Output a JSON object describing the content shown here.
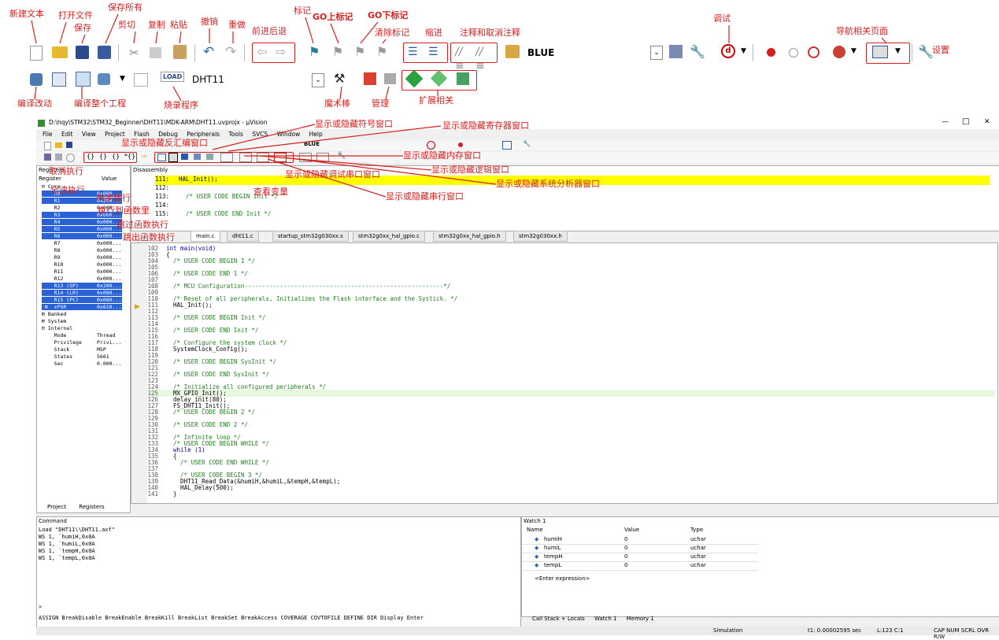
{
  "toolbar_font_combo": "BLUE",
  "target_combo": "DHT11",
  "load_label": "LOAD",
  "annotations": {
    "new_file": "新建文本",
    "open_file": "打开文件",
    "save": "保存",
    "save_all": "保存所有",
    "cut": "剪切",
    "copy": "复制",
    "paste": "粘贴",
    "undo": "撤销",
    "redo": "重做",
    "nav_back_forward": "前进后退",
    "bookmark": "标记",
    "goto_prev_bookmark": "GO上标记",
    "goto_next_bookmark": "GO下标记",
    "clear_bookmarks": "清除标记",
    "indent": "缩进",
    "comment_uncomment": "注释和取消注释",
    "debug": "调试",
    "nav_pages": "导航相关页面",
    "settings": "设置",
    "compile_changed": "编译改动",
    "build_all": "编译整个工程",
    "download": "烧录程序",
    "magic_wand": "魔术棒",
    "manage": "管理",
    "extensions": "扩展相关",
    "show_symbol": "显示或隐藏符号窗口",
    "show_register": "显示或隐藏寄存器窗口",
    "show_disasm": "显示或隐藏反汇编窗口",
    "show_memory": "显示或隐藏内存窗口",
    "show_logic": "显示或隐藏逻辑窗口",
    "show_debug_serial": "显示或隐藏调试串口窗口",
    "show_serial": "显示或隐藏串行窗口",
    "show_sys_analyzer": "显示或隐藏系统分析器窗口",
    "watch_vars": "查看变量",
    "cancel_run": "取消执行",
    "run": "全速执行",
    "step": "单步执行",
    "step_into": "执行到函数里",
    "step_over": "跳过函数执行",
    "step_out": "跳出函数执行"
  },
  "window": {
    "title": "D:\\hqy\\STM32\\STM32_Beginner\\DHT11\\MDK-ARM\\DHT11.uvprojx - µVision",
    "menu": [
      "File",
      "Edit",
      "View",
      "Project",
      "Flash",
      "Debug",
      "Peripherals",
      "Tools",
      "SVCS",
      "Window",
      "Help"
    ],
    "mini_font_combo": "BLUE",
    "min": "—",
    "max": "□",
    "close": "✕"
  },
  "registers": {
    "title": "Registers",
    "col_register": "Register",
    "col_value": "Value",
    "rows": [
      {
        "name": "⊟ Core",
        "value": "",
        "sel": false
      },
      {
        "name": "    R0",
        "value": "0x080...",
        "sel": true
      },
      {
        "name": "    R1",
        "value": "0x200...",
        "sel": true
      },
      {
        "name": "    R2",
        "value": "0x000...",
        "sel": false
      },
      {
        "name": "    R3",
        "value": "0x000...",
        "sel": true
      },
      {
        "name": "    R4",
        "value": "0x000...",
        "sel": true
      },
      {
        "name": "    R5",
        "value": "0x000...",
        "sel": true
      },
      {
        "name": "    R6",
        "value": "0x000...",
        "sel": true
      },
      {
        "name": "    R7",
        "value": "0x000...",
        "sel": false
      },
      {
        "name": "    R8",
        "value": "0x000...",
        "sel": false
      },
      {
        "name": "    R9",
        "value": "0x000...",
        "sel": false
      },
      {
        "name": "    R10",
        "value": "0x000...",
        "sel": false
      },
      {
        "name": "    R11",
        "value": "0x000...",
        "sel": false
      },
      {
        "name": "    R12",
        "value": "0x000...",
        "sel": false
      },
      {
        "name": "    R13 (SP)",
        "value": "0x200...",
        "sel": true
      },
      {
        "name": "    R14 (LR)",
        "value": "0x080...",
        "sel": true
      },
      {
        "name": "    R15 (PC)",
        "value": "0x080...",
        "sel": true
      },
      {
        "name": " ⊞  xPSR",
        "value": "0x610...",
        "sel": true
      },
      {
        "name": "⊞ Banked",
        "value": "",
        "sel": false
      },
      {
        "name": "⊞ System",
        "value": "",
        "sel": false
      },
      {
        "name": "⊟ Internal",
        "value": "",
        "sel": false
      },
      {
        "name": "    Mode",
        "value": "Thread",
        "sel": false
      },
      {
        "name": "    Privilege",
        "value": "Privi...",
        "sel": false
      },
      {
        "name": "    Stack",
        "value": "MSP",
        "sel": false
      },
      {
        "name": "    States",
        "value": "5661",
        "sel": false
      },
      {
        "name": "    Sec",
        "value": "0.000...",
        "sel": false
      }
    ],
    "tab_project": "Project",
    "tab_registers": "Registers"
  },
  "disassembly": {
    "title": "Disassembly",
    "lines": [
      {
        "ln": "111:",
        "text": "HAL_Init();"
      },
      {
        "ln": "112:",
        "text": ""
      },
      {
        "ln": "113:",
        "text": "  /* USER CODE BEGIN Init */"
      },
      {
        "ln": "114:",
        "text": ""
      },
      {
        "ln": "115:",
        "text": "  /* USER CODE END Init */"
      }
    ]
  },
  "editor": {
    "tabs": [
      "main.c",
      "dht11.c",
      "startup_stm32g030xx.s",
      "stm32g0xx_hal_gpio.c",
      "stm32g0xx_hal_gpio.h",
      "stm32g030xx.h"
    ],
    "lines": [
      {
        "ln": "102",
        "text": "int main(void)"
      },
      {
        "ln": "103",
        "text": "{"
      },
      {
        "ln": "104",
        "text": "  /* USER CODE BEGIN 1 */"
      },
      {
        "ln": "105",
        "text": ""
      },
      {
        "ln": "106",
        "text": "  /* USER CODE END 1 */"
      },
      {
        "ln": "107",
        "text": ""
      },
      {
        "ln": "108",
        "text": "  /* MCU Configuration--------------------------------------------------------*/"
      },
      {
        "ln": "109",
        "text": ""
      },
      {
        "ln": "110",
        "text": "  /* Reset of all peripherals, Initializes the Flash interface and the Systick. */"
      },
      {
        "ln": "111",
        "text": "  HAL_Init();"
      },
      {
        "ln": "112",
        "text": ""
      },
      {
        "ln": "113",
        "text": "  /* USER CODE BEGIN Init */"
      },
      {
        "ln": "114",
        "text": ""
      },
      {
        "ln": "115",
        "text": "  /* USER CODE END Init */"
      },
      {
        "ln": "116",
        "text": ""
      },
      {
        "ln": "117",
        "text": "  /* Configure the system clock */"
      },
      {
        "ln": "118",
        "text": "  SystemClock_Config();"
      },
      {
        "ln": "119",
        "text": ""
      },
      {
        "ln": "120",
        "text": "  /* USER CODE BEGIN SysInit */"
      },
      {
        "ln": "121",
        "text": ""
      },
      {
        "ln": "122",
        "text": "  /* USER CODE END SysInit */"
      },
      {
        "ln": "123",
        "text": ""
      },
      {
        "ln": "124",
        "text": "  /* Initialize all configured peripherals */"
      },
      {
        "ln": "125",
        "text": "  MX_GPIO_Init();"
      },
      {
        "ln": "126",
        "text": "  delay_init(80);"
      },
      {
        "ln": "127",
        "text": "  FS_DHT11_Init();"
      },
      {
        "ln": "128",
        "text": "  /* USER CODE BEGIN 2 */"
      },
      {
        "ln": "129",
        "text": ""
      },
      {
        "ln": "130",
        "text": "  /* USER CODE END 2 */"
      },
      {
        "ln": "131",
        "text": ""
      },
      {
        "ln": "132",
        "text": "  /* Infinite loop */"
      },
      {
        "ln": "133",
        "text": "  /* USER CODE BEGIN WHILE */"
      },
      {
        "ln": "134",
        "text": "  while (1)"
      },
      {
        "ln": "135",
        "text": "  {"
      },
      {
        "ln": "136",
        "text": "    /* USER CODE END WHILE */"
      },
      {
        "ln": "137",
        "text": ""
      },
      {
        "ln": "138",
        "text": "    /* USER CODE BEGIN 3 */"
      },
      {
        "ln": "139",
        "text": "    DHT11_Read_Data(&humiH,&humiL,&tempH,&tempL);"
      },
      {
        "ln": "140",
        "text": "    HAL_Delay(500);"
      },
      {
        "ln": "141",
        "text": "  }"
      }
    ]
  },
  "command": {
    "title": "Command",
    "lines": [
      "Load \"DHT11\\\\DHT11.axf\"",
      "WS 1, `humiH,0x0A",
      "WS 1, `humiL,0x0A",
      "WS 1, `tempH,0x0A",
      "WS 1, `tempL,0x0A"
    ],
    "prompt": ">",
    "help": "ASSIGN BreakDisable BreakEnable BreakKill BreakList BreakSet BreakAccess COVERAGE COVTOFILE DEFINE DIR Display Enter"
  },
  "watch": {
    "title": "Watch 1",
    "col_name": "Name",
    "col_value": "Value",
    "col_type": "Type",
    "rows": [
      {
        "name": "humiH",
        "value": "0",
        "type": "uchar"
      },
      {
        "name": "humiL",
        "value": "0",
        "type": "uchar"
      },
      {
        "name": "tempH",
        "value": "0",
        "type": "uchar"
      },
      {
        "name": "tempL",
        "value": "0",
        "type": "uchar"
      }
    ],
    "enter_expr": "<Enter expression>",
    "tabs": [
      "Call Stack + Locals",
      "Watch 1",
      "Memory 1"
    ]
  },
  "status": {
    "mode": "Simulation",
    "time": "t1: 0.00002595 sec",
    "pos": "L:123 C:1",
    "flags": "CAP NUM SCRL OVR R/W"
  },
  "colors": {
    "annotation": "#d62020",
    "selection": "#2a62d6",
    "highlight": "#ffff00",
    "comment": "#208020"
  }
}
